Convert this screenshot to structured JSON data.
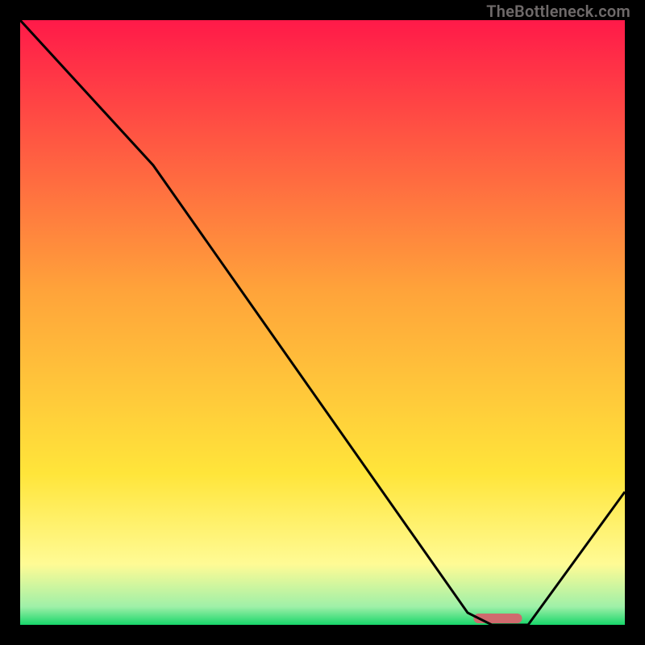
{
  "watermark": "TheBottleneck.com",
  "chart_data": {
    "type": "line",
    "title": "",
    "xlabel": "",
    "ylabel": "",
    "xlim": [
      0,
      100
    ],
    "ylim": [
      0,
      100
    ],
    "grid": false,
    "legend": false,
    "marker": {
      "x_center": 79,
      "x_width": 8,
      "color": "#cf6a6e"
    },
    "curve": [
      {
        "x": 0,
        "y": 100
      },
      {
        "x": 22,
        "y": 76
      },
      {
        "x": 74,
        "y": 2
      },
      {
        "x": 78,
        "y": 0
      },
      {
        "x": 84,
        "y": 0
      },
      {
        "x": 100,
        "y": 22
      }
    ],
    "background_gradient": [
      {
        "pos": 0.0,
        "color": "#ff1a49"
      },
      {
        "pos": 0.45,
        "color": "#ffa43a"
      },
      {
        "pos": 0.75,
        "color": "#ffe53a"
      },
      {
        "pos": 0.9,
        "color": "#fffb95"
      },
      {
        "pos": 0.97,
        "color": "#9ff0a8"
      },
      {
        "pos": 1.0,
        "color": "#18d66a"
      }
    ]
  }
}
